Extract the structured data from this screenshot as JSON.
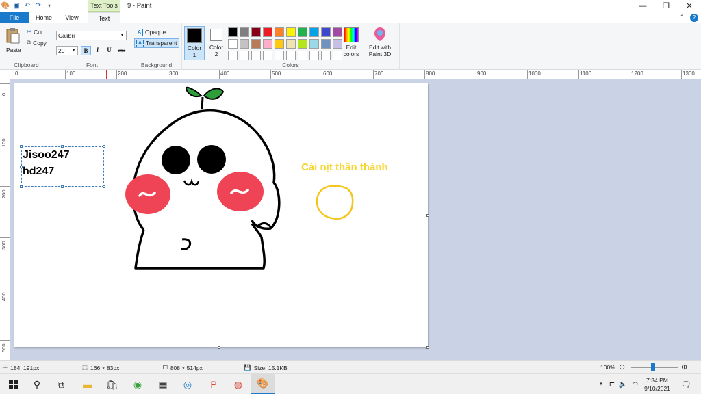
{
  "titlebar": {
    "context_tab": "Text Tools",
    "doc_title": "9 - Paint"
  },
  "tabs": {
    "file": "File",
    "home": "Home",
    "view": "View",
    "text": "Text"
  },
  "clipboard": {
    "paste": "Paste",
    "cut": "Cut",
    "copy": "Copy",
    "label": "Clipboard"
  },
  "font": {
    "family": "Calibri",
    "size": "20",
    "bold": "B",
    "italic": "I",
    "underline": "U",
    "strike": "abc",
    "label": "Font"
  },
  "background": {
    "opaque": "Opaque",
    "transparent": "Transparent",
    "label": "Background"
  },
  "colors": {
    "color1_label": "Color",
    "color1_num": "1",
    "color2_label": "Color",
    "color2_num": "2",
    "color1_value": "#000000",
    "color2_value": "#ffffff",
    "palette": [
      "#000000",
      "#7f7f7f",
      "#880015",
      "#ed1c24",
      "#ff7f27",
      "#fff200",
      "#22b14c",
      "#00a2e8",
      "#3f48cc",
      "#a349a4",
      "#ffffff",
      "#c3c3c3",
      "#b97a57",
      "#ffaec9",
      "#ffc90e",
      "#efe4b0",
      "#b5e61d",
      "#99d9ea",
      "#7092be",
      "#c8bfe7",
      "#ffffff",
      "#ffffff",
      "#ffffff",
      "#ffffff",
      "#ffffff",
      "#ffffff",
      "#ffffff",
      "#ffffff",
      "#ffffff",
      "#ffffff"
    ],
    "edit_colors_1": "Edit",
    "edit_colors_2": "colors",
    "edit3d_1": "Edit with",
    "edit3d_2": "Paint 3D",
    "label": "Colors"
  },
  "ruler": {
    "top": [
      "0",
      "100",
      "200",
      "300",
      "400",
      "500",
      "600",
      "700",
      "800",
      "900",
      "1000",
      "1100",
      "1200",
      "1300"
    ],
    "left": [
      "0",
      "100",
      "200",
      "300",
      "400",
      "500"
    ]
  },
  "canvas": {
    "text_line1": "Jisoo247",
    "text_line2": "hd247",
    "viet_text": "Cái nịt thần thánh"
  },
  "status": {
    "cursor": "184, 191px",
    "selection": "166 × 83px",
    "canvas_size": "808 × 514px",
    "file_size": "Size: 15.1KB",
    "zoom": "100%"
  },
  "taskbar": {
    "time": "7:34 PM",
    "date": "9/10/2021"
  }
}
